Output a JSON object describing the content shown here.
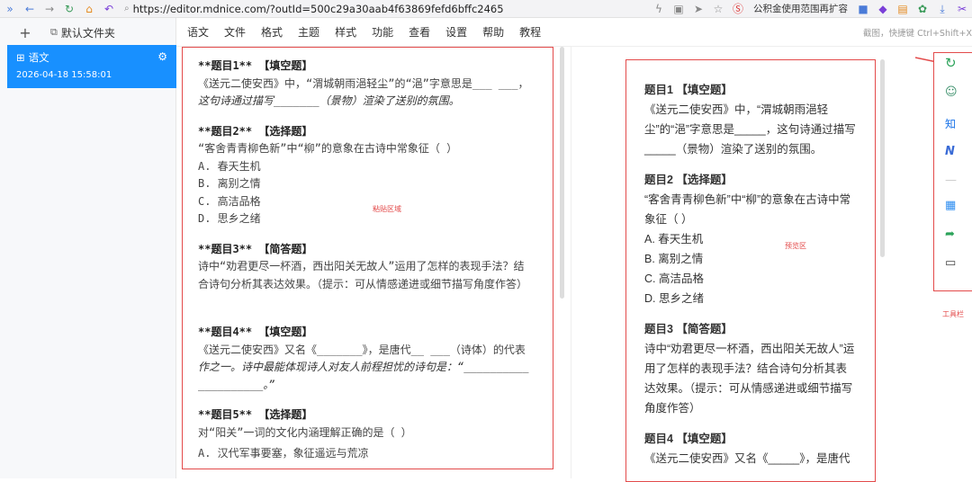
{
  "browser": {
    "url": "https://editor.mdnice.com/?outId=500c29a30aab4f63869fefd6bffc2465",
    "extension_text": "公积金使用范围再扩容"
  },
  "sidebar": {
    "folder_label": "默认文件夹",
    "doc": {
      "title": "语文",
      "date": "2026-04-18 15:58:01"
    }
  },
  "menu": {
    "items": [
      "语文",
      "文件",
      "格式",
      "主题",
      "样式",
      "功能",
      "查看",
      "设置",
      "帮助",
      "教程"
    ],
    "hint": "截图，快捷键 Ctrl+Shift+X"
  },
  "labels": {
    "paste_area": "粘贴区域",
    "preview_area": "预览区",
    "toolbar": "工具栏"
  },
  "editor": {
    "q1_h": "**题目1** 【填空题】",
    "q1_a": "《送元二使安西》中，“渭城朝雨浥轻尘”的“浥”字意思是___ ___，",
    "q1_b": "这句诗通过描写_______（景物）渲染了送别的氛围。",
    "q2_h": "**题目2** 【选择题】",
    "q2_a": "“客舍青青柳色新”中“柳”的意象在古诗中常象征（ ）",
    "q2_o1": "A. 春天生机",
    "q2_o2": "B. 离别之情",
    "q2_o3": "C. 高洁品格",
    "q2_o4": "D. 思乡之绪",
    "q3_h": "**题目3** 【简答题】",
    "q3_a": "诗中“劝君更尽一杯酒，西出阳关无故人”运用了怎样的表现手法？结",
    "q3_b": "合诗句分析其表达效果。（提示：可从情感递进或细节描写角度作答）",
    "q4_h": "**题目4** 【填空题】",
    "q4_a": "《送元二使安西》又名《_______》，是唐代__ ___（诗体）的代表",
    "q4_b": "作之一。诗中最能体现诗人对友人前程担忧的诗句是：“__________",
    "q4_c": "__________。”",
    "q5_h": "**题目5** 【选择题】",
    "q5_a": "对“阳关”一词的文化内涵理解正确的是（ ）",
    "q5_o1": "A. 汉代军事要塞，象征遥远与荒凉"
  },
  "preview": {
    "q1_h": "题目1 【填空题】",
    "q1_a": "《送元二使安西》中，“渭城朝雨浥轻尘”的“浥”字意思是_____，这句诗通过描写_____（景物）渲染了送别的氛围。",
    "q2_h": "题目2 【选择题】",
    "q2_a": "“客舍青青柳色新”中“柳”的意象在古诗中常象征（ ）",
    "q2_o1": "A. 春天生机",
    "q2_o2": "B. 离别之情",
    "q2_o3": "C. 高洁品格",
    "q2_o4": "D. 思乡之绪",
    "q3_h": "题目3 【简答题】",
    "q3_a": "诗中“劝君更尽一杯酒，西出阳关无故人”运用了怎样的表现手法？结合诗句分析其表达效果。（提示：可从情感递进或细节描写角度作答）",
    "q4_h": "题目4 【填空题】",
    "q4_a": "《送元二使安西》又名《_____》，是唐代"
  },
  "toolbar": {
    "zhihu": "知"
  }
}
